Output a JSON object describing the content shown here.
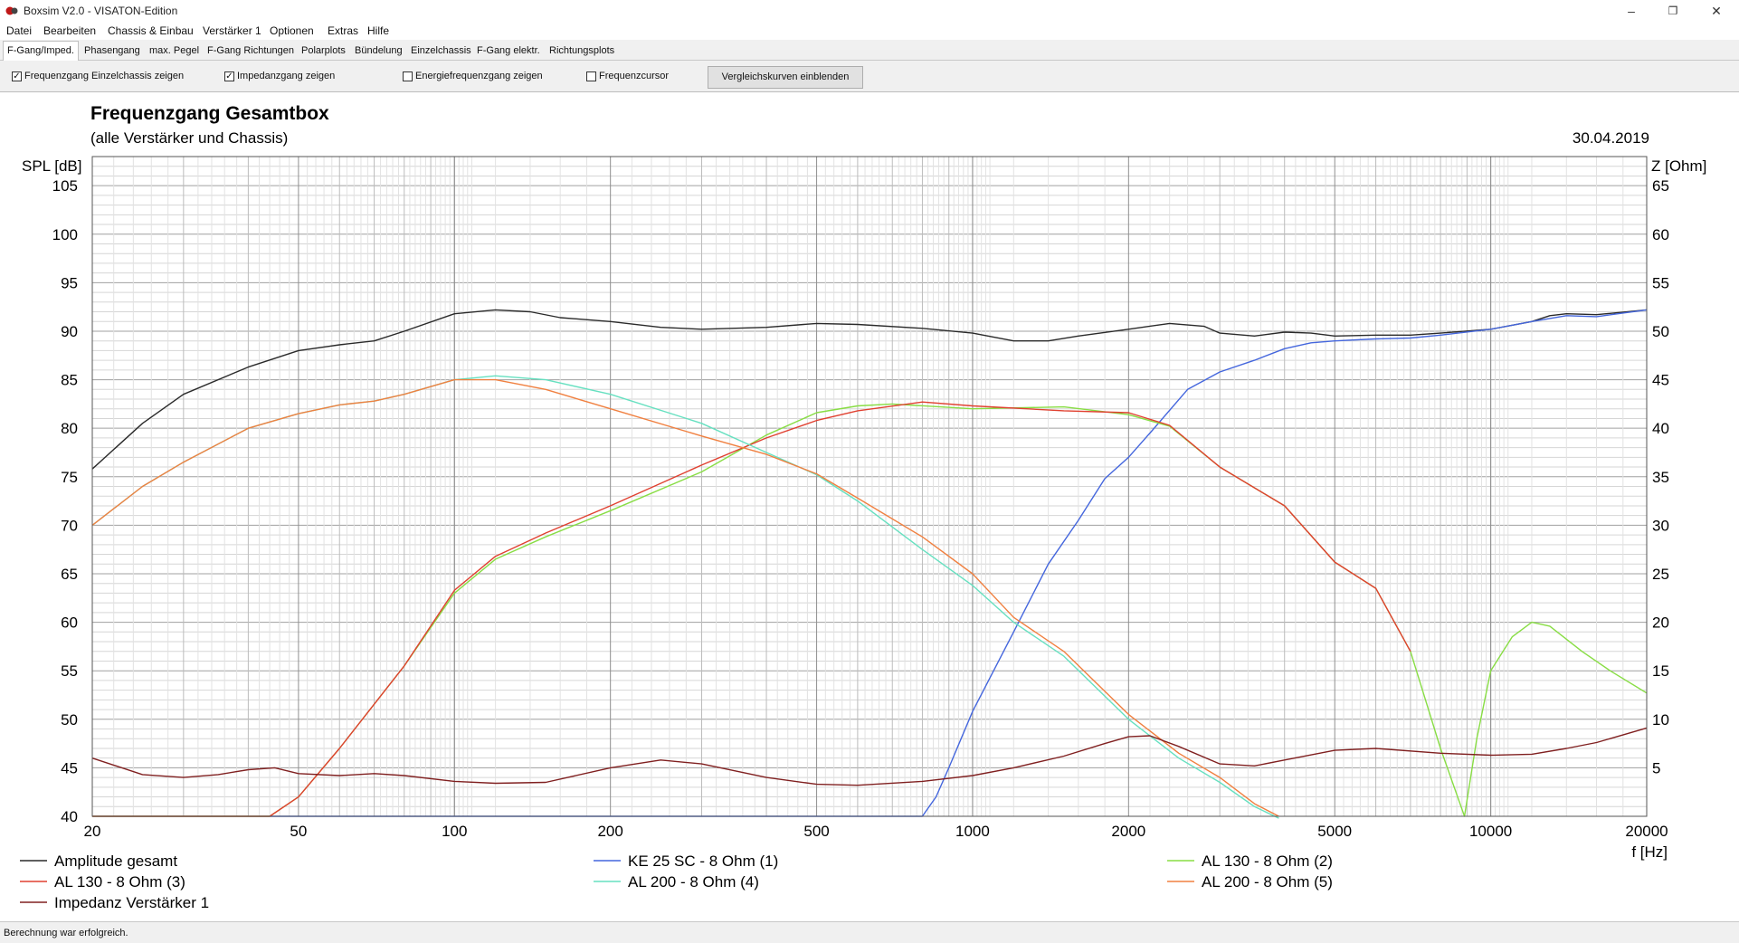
{
  "window": {
    "title": "Boxsim V2.0 - VISATON-Edition",
    "controls": {
      "minimize": "–",
      "maximize": "❐",
      "close": "✕"
    }
  },
  "menu": [
    "Datei",
    "Bearbeiten",
    "Chassis & Einbau",
    "Verstärker 1",
    "Optionen",
    "Extras",
    "Hilfe"
  ],
  "tabs": [
    "F-Gang/Imped.",
    "Phasengang",
    "max. Pegel",
    "F-Gang Richtungen",
    "Polarplots",
    "Bündelung",
    "Einzelchassis",
    "F-Gang elektr.",
    "Richtungsplots"
  ],
  "active_tab": "F-Gang/Imped.",
  "options": {
    "checkboxes": [
      {
        "label": "Frequenzgang Einzelchassis zeigen",
        "checked": true
      },
      {
        "label": "Impedanzgang zeigen",
        "checked": true
      },
      {
        "label": "Energiefrequenzgang zeigen",
        "checked": false
      },
      {
        "label": "Frequenzcursor",
        "checked": false
      }
    ],
    "compare_button": "Vergleichskurven einblenden"
  },
  "status": "Berechnung war erfolgreich.",
  "chart_data": {
    "type": "line",
    "title": "Frequenzgang Gesamtbox",
    "subtitle": "(alle Verstärker und Chassis)",
    "date": "30.04.2019",
    "xlabel": "f [Hz]",
    "ylabel": "SPL [dB]",
    "y2label": "Z [Ohm]",
    "xscale": "log",
    "xlim": [
      20,
      20000
    ],
    "ylim": [
      40,
      108
    ],
    "y2lim": [
      0,
      68
    ],
    "xticks": [
      20,
      50,
      100,
      200,
      500,
      1000,
      2000,
      5000,
      10000,
      20000
    ],
    "yticks": [
      40,
      45,
      50,
      55,
      60,
      65,
      70,
      75,
      80,
      85,
      90,
      95,
      100,
      105
    ],
    "y2ticks": [
      5,
      10,
      15,
      20,
      25,
      30,
      35,
      40,
      45,
      50,
      55,
      60,
      65
    ],
    "grid": true,
    "legend_position": "bottom",
    "series": [
      {
        "name": "Amplitude gesamt",
        "color": "#2a2a2a",
        "axis": "left",
        "points": [
          [
            20,
            75.8
          ],
          [
            25,
            80.5
          ],
          [
            30,
            83.5
          ],
          [
            40,
            86.3
          ],
          [
            50,
            88
          ],
          [
            60,
            88.6
          ],
          [
            70,
            89
          ],
          [
            80,
            90
          ],
          [
            100,
            91.8
          ],
          [
            120,
            92.2
          ],
          [
            140,
            92
          ],
          [
            160,
            91.4
          ],
          [
            200,
            91
          ],
          [
            250,
            90.4
          ],
          [
            300,
            90.2
          ],
          [
            400,
            90.4
          ],
          [
            500,
            90.8
          ],
          [
            600,
            90.7
          ],
          [
            800,
            90.3
          ],
          [
            1000,
            89.8
          ],
          [
            1200,
            89
          ],
          [
            1400,
            89
          ],
          [
            1600,
            89.5
          ],
          [
            2000,
            90.2
          ],
          [
            2400,
            90.8
          ],
          [
            2800,
            90.5
          ],
          [
            3000,
            89.8
          ],
          [
            3500,
            89.5
          ],
          [
            4000,
            89.9
          ],
          [
            4500,
            89.8
          ],
          [
            5000,
            89.5
          ],
          [
            6000,
            89.6
          ],
          [
            7000,
            89.6
          ],
          [
            8000,
            89.8
          ],
          [
            10000,
            90.2
          ],
          [
            12000,
            91
          ],
          [
            13000,
            91.6
          ],
          [
            14000,
            91.8
          ],
          [
            16000,
            91.7
          ],
          [
            20000,
            92.2
          ]
        ]
      },
      {
        "name": "KE 25 SC - 8 Ohm     (1)",
        "color": "#4466dd",
        "axis": "left",
        "points": [
          [
            20,
            40
          ],
          [
            800,
            40
          ],
          [
            850,
            42
          ],
          [
            900,
            45
          ],
          [
            1000,
            50.8
          ],
          [
            1200,
            59
          ],
          [
            1400,
            66
          ],
          [
            1600,
            70.5
          ],
          [
            1800,
            74.8
          ],
          [
            2000,
            77
          ],
          [
            2200,
            79.5
          ],
          [
            2600,
            84
          ],
          [
            3000,
            85.8
          ],
          [
            3500,
            87
          ],
          [
            4000,
            88.2
          ],
          [
            4500,
            88.8
          ],
          [
            5000,
            89
          ],
          [
            6000,
            89.2
          ],
          [
            7000,
            89.3
          ],
          [
            8000,
            89.6
          ],
          [
            10000,
            90.2
          ],
          [
            12000,
            91
          ],
          [
            14000,
            91.6
          ],
          [
            16000,
            91.5
          ],
          [
            20000,
            92.2
          ]
        ]
      },
      {
        "name": "AL 130 - 8 Ohm (2)",
        "color": "#88dd44",
        "axis": "left",
        "points": [
          [
            20,
            40
          ],
          [
            44,
            40
          ],
          [
            50,
            42
          ],
          [
            60,
            47
          ],
          [
            80,
            55.5
          ],
          [
            100,
            63
          ],
          [
            120,
            66.5
          ],
          [
            150,
            68.8
          ],
          [
            200,
            71.5
          ],
          [
            300,
            75.5
          ],
          [
            400,
            79.3
          ],
          [
            500,
            81.6
          ],
          [
            600,
            82.3
          ],
          [
            700,
            82.5
          ],
          [
            1000,
            82
          ],
          [
            1500,
            82.2
          ],
          [
            2000,
            81.4
          ],
          [
            2400,
            80.2
          ],
          [
            3000,
            76
          ],
          [
            4000,
            72
          ],
          [
            5000,
            66.2
          ],
          [
            6000,
            63.5
          ],
          [
            7000,
            57
          ],
          [
            8000,
            47
          ],
          [
            8900,
            40
          ],
          [
            9400,
            48
          ],
          [
            10000,
            55
          ],
          [
            11000,
            58.5
          ],
          [
            12000,
            60
          ],
          [
            13000,
            59.6
          ],
          [
            15000,
            57
          ],
          [
            17000,
            55
          ],
          [
            20000,
            52.7
          ]
        ]
      },
      {
        "name": "AL 130 - 8 Ohm (3)",
        "color": "#e04030",
        "axis": "left",
        "points": [
          [
            20,
            40
          ],
          [
            44,
            40
          ],
          [
            50,
            42
          ],
          [
            60,
            47
          ],
          [
            80,
            55.5
          ],
          [
            100,
            63.3
          ],
          [
            120,
            66.8
          ],
          [
            150,
            69.2
          ],
          [
            200,
            72
          ],
          [
            300,
            76.2
          ],
          [
            400,
            79
          ],
          [
            500,
            80.8
          ],
          [
            600,
            81.8
          ],
          [
            800,
            82.7
          ],
          [
            1000,
            82.3
          ],
          [
            1500,
            81.8
          ],
          [
            2000,
            81.6
          ],
          [
            2400,
            80.3
          ],
          [
            3000,
            76
          ],
          [
            4000,
            72
          ],
          [
            5000,
            66.2
          ],
          [
            6000,
            63.5
          ],
          [
            7000,
            57
          ]
        ]
      },
      {
        "name": "AL 200 - 8 Ohm (4)",
        "color": "#66e0c0",
        "axis": "left",
        "points": [
          [
            20,
            70
          ],
          [
            25,
            74
          ],
          [
            30,
            76.5
          ],
          [
            40,
            80
          ],
          [
            50,
            81.5
          ],
          [
            60,
            82.4
          ],
          [
            70,
            82.8
          ],
          [
            80,
            83.5
          ],
          [
            100,
            85
          ],
          [
            120,
            85.4
          ],
          [
            150,
            85
          ],
          [
            200,
            83.5
          ],
          [
            300,
            80.5
          ],
          [
            400,
            77.5
          ],
          [
            500,
            75.2
          ],
          [
            600,
            72.5
          ],
          [
            800,
            67.5
          ],
          [
            1000,
            63.8
          ],
          [
            1200,
            60
          ],
          [
            1500,
            56.5
          ],
          [
            2000,
            50
          ],
          [
            2500,
            46
          ],
          [
            3000,
            43.5
          ],
          [
            3500,
            41
          ],
          [
            3900,
            39.8
          ]
        ]
      },
      {
        "name": "AL 200 - 8 Ohm (5)",
        "color": "#f08040",
        "axis": "left",
        "points": [
          [
            20,
            70
          ],
          [
            25,
            74
          ],
          [
            30,
            76.5
          ],
          [
            40,
            80
          ],
          [
            50,
            81.5
          ],
          [
            60,
            82.4
          ],
          [
            70,
            82.8
          ],
          [
            80,
            83.5
          ],
          [
            100,
            85
          ],
          [
            120,
            85
          ],
          [
            150,
            84
          ],
          [
            200,
            82
          ],
          [
            300,
            79.2
          ],
          [
            400,
            77.3
          ],
          [
            500,
            75.3
          ],
          [
            600,
            72.8
          ],
          [
            800,
            68.8
          ],
          [
            1000,
            65
          ],
          [
            1200,
            60.5
          ],
          [
            1500,
            57
          ],
          [
            2000,
            50.5
          ],
          [
            2500,
            46.5
          ],
          [
            3000,
            44
          ],
          [
            3500,
            41.3
          ],
          [
            3900,
            40
          ]
        ]
      },
      {
        "name": "Impedanz Verstärker 1",
        "color": "#802020",
        "axis": "right",
        "points": [
          [
            20,
            6
          ],
          [
            25,
            4.3
          ],
          [
            30,
            4
          ],
          [
            35,
            4.3
          ],
          [
            40,
            4.8
          ],
          [
            45,
            5
          ],
          [
            50,
            4.4
          ],
          [
            60,
            4.2
          ],
          [
            70,
            4.4
          ],
          [
            80,
            4.2
          ],
          [
            100,
            3.6
          ],
          [
            120,
            3.4
          ],
          [
            150,
            3.5
          ],
          [
            200,
            5
          ],
          [
            250,
            5.8
          ],
          [
            300,
            5.4
          ],
          [
            400,
            4
          ],
          [
            500,
            3.3
          ],
          [
            600,
            3.2
          ],
          [
            800,
            3.6
          ],
          [
            1000,
            4.2
          ],
          [
            1200,
            5
          ],
          [
            1500,
            6.2
          ],
          [
            1800,
            7.5
          ],
          [
            2000,
            8.2
          ],
          [
            2200,
            8.3
          ],
          [
            2500,
            7.2
          ],
          [
            3000,
            5.4
          ],
          [
            3500,
            5.2
          ],
          [
            4000,
            5.8
          ],
          [
            5000,
            6.8
          ],
          [
            6000,
            7
          ],
          [
            8000,
            6.5
          ],
          [
            10000,
            6.3
          ],
          [
            12000,
            6.4
          ],
          [
            14000,
            7
          ],
          [
            16000,
            7.6
          ],
          [
            20000,
            9.1
          ]
        ]
      }
    ]
  }
}
